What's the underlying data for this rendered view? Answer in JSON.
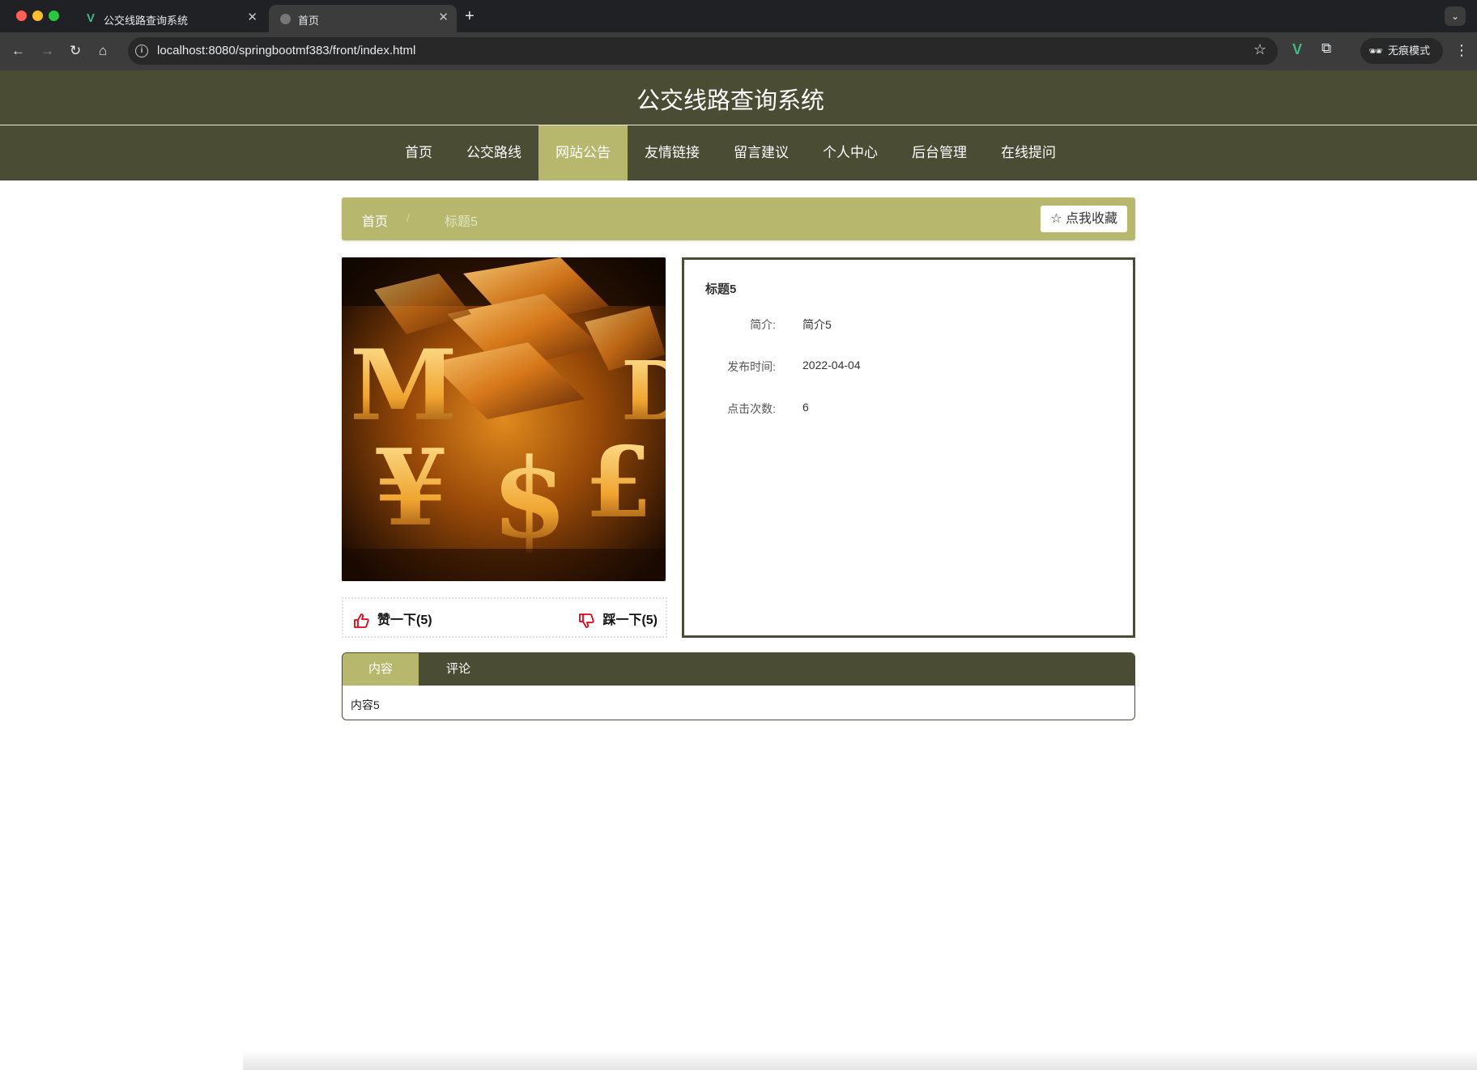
{
  "browser": {
    "tabs": [
      {
        "title": "公交线路查询系统",
        "favicon": "vue-logo-icon",
        "active": false
      },
      {
        "title": "首页",
        "favicon": "globe-icon",
        "active": true
      }
    ],
    "url": "localhost:8080/springbootmf383/front/index.html",
    "incognito_label": "无痕模式"
  },
  "site": {
    "title": "公交线路查询系统",
    "nav": [
      {
        "label": "首页",
        "active": false
      },
      {
        "label": "公交路线",
        "active": false
      },
      {
        "label": "网站公告",
        "active": true
      },
      {
        "label": "友情链接",
        "active": false
      },
      {
        "label": "留言建议",
        "active": false
      },
      {
        "label": "个人中心",
        "active": false
      },
      {
        "label": "后台管理",
        "active": false
      },
      {
        "label": "在线提问",
        "active": false
      }
    ]
  },
  "breadcrumb": {
    "home": "首页",
    "separator": "/",
    "current": "标题5"
  },
  "favorite": {
    "label": "点我收藏",
    "icon": "star-outline-icon"
  },
  "votes": {
    "up_label": "赞一下(5)",
    "down_label": "踩一下(5)",
    "icon_color": "#e60012"
  },
  "detail": {
    "title": "标题5",
    "fields": [
      {
        "label": "简介:",
        "value": "简介5"
      },
      {
        "label": "发布时间:",
        "value": "2022-04-04"
      },
      {
        "label": "点击次数:",
        "value": "6"
      }
    ]
  },
  "content_tabs": {
    "tabs": [
      {
        "label": "内容",
        "active": true
      },
      {
        "label": "评论",
        "active": false
      }
    ],
    "body": "内容5"
  },
  "colors": {
    "brand_dark": "#4b4c34",
    "brand_accent": "#b7b86d"
  }
}
